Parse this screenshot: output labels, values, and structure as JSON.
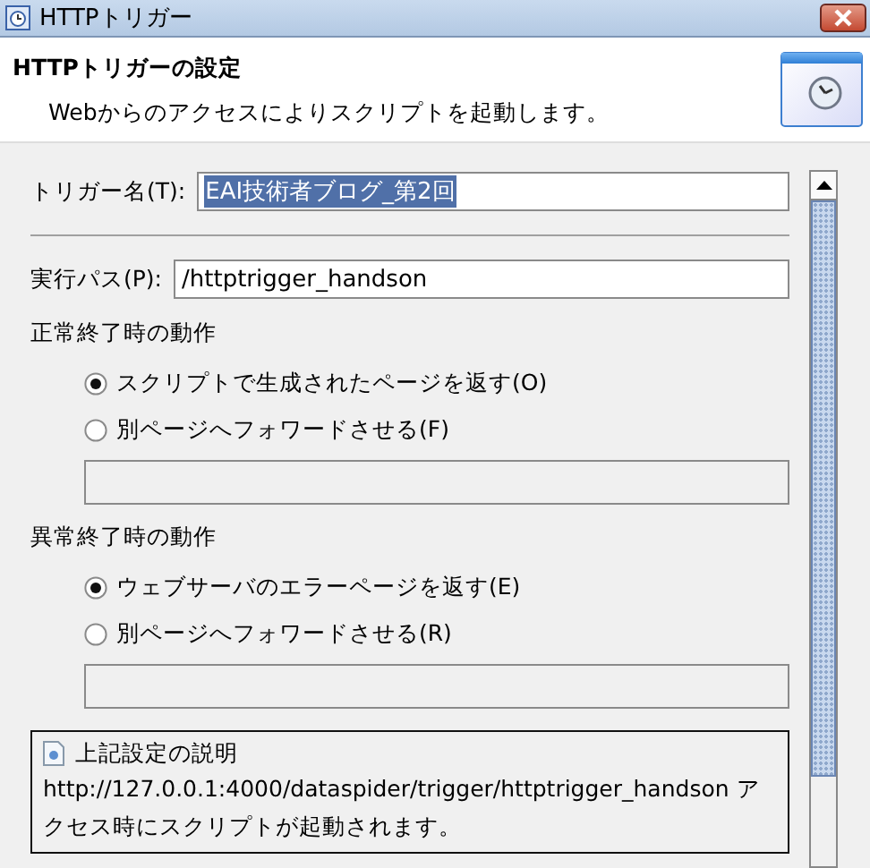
{
  "window": {
    "title": "HTTPトリガー"
  },
  "header": {
    "title": "HTTPトリガーの設定",
    "description": "Webからのアクセスによりスクリプトを起動します。"
  },
  "trigger_name": {
    "label": "トリガー名(T):",
    "value": "EAI技術者ブログ_第2回",
    "text_selected": true
  },
  "path": {
    "label": "実行パス(P):",
    "value": "/httptrigger_handson"
  },
  "groups": [
    {
      "title": "正常終了時の動作",
      "options": [
        {
          "label": "スクリプトで生成されたページを返す(O)",
          "selected": true
        },
        {
          "label": "別ページへフォワードさせる(F)",
          "selected": false
        }
      ]
    },
    {
      "title": "異常終了時の動作",
      "options": [
        {
          "label": "ウェブサーバのエラーページを返す(E)",
          "selected": true
        },
        {
          "label": "別ページへフォワードさせる(R)",
          "selected": false
        }
      ]
    }
  ],
  "info": {
    "title": "上記設定の説明",
    "text": "http://127.0.0.1:4000/dataspider/trigger/httptrigger_handson アクセス時にスクリプトが起動されます。"
  }
}
